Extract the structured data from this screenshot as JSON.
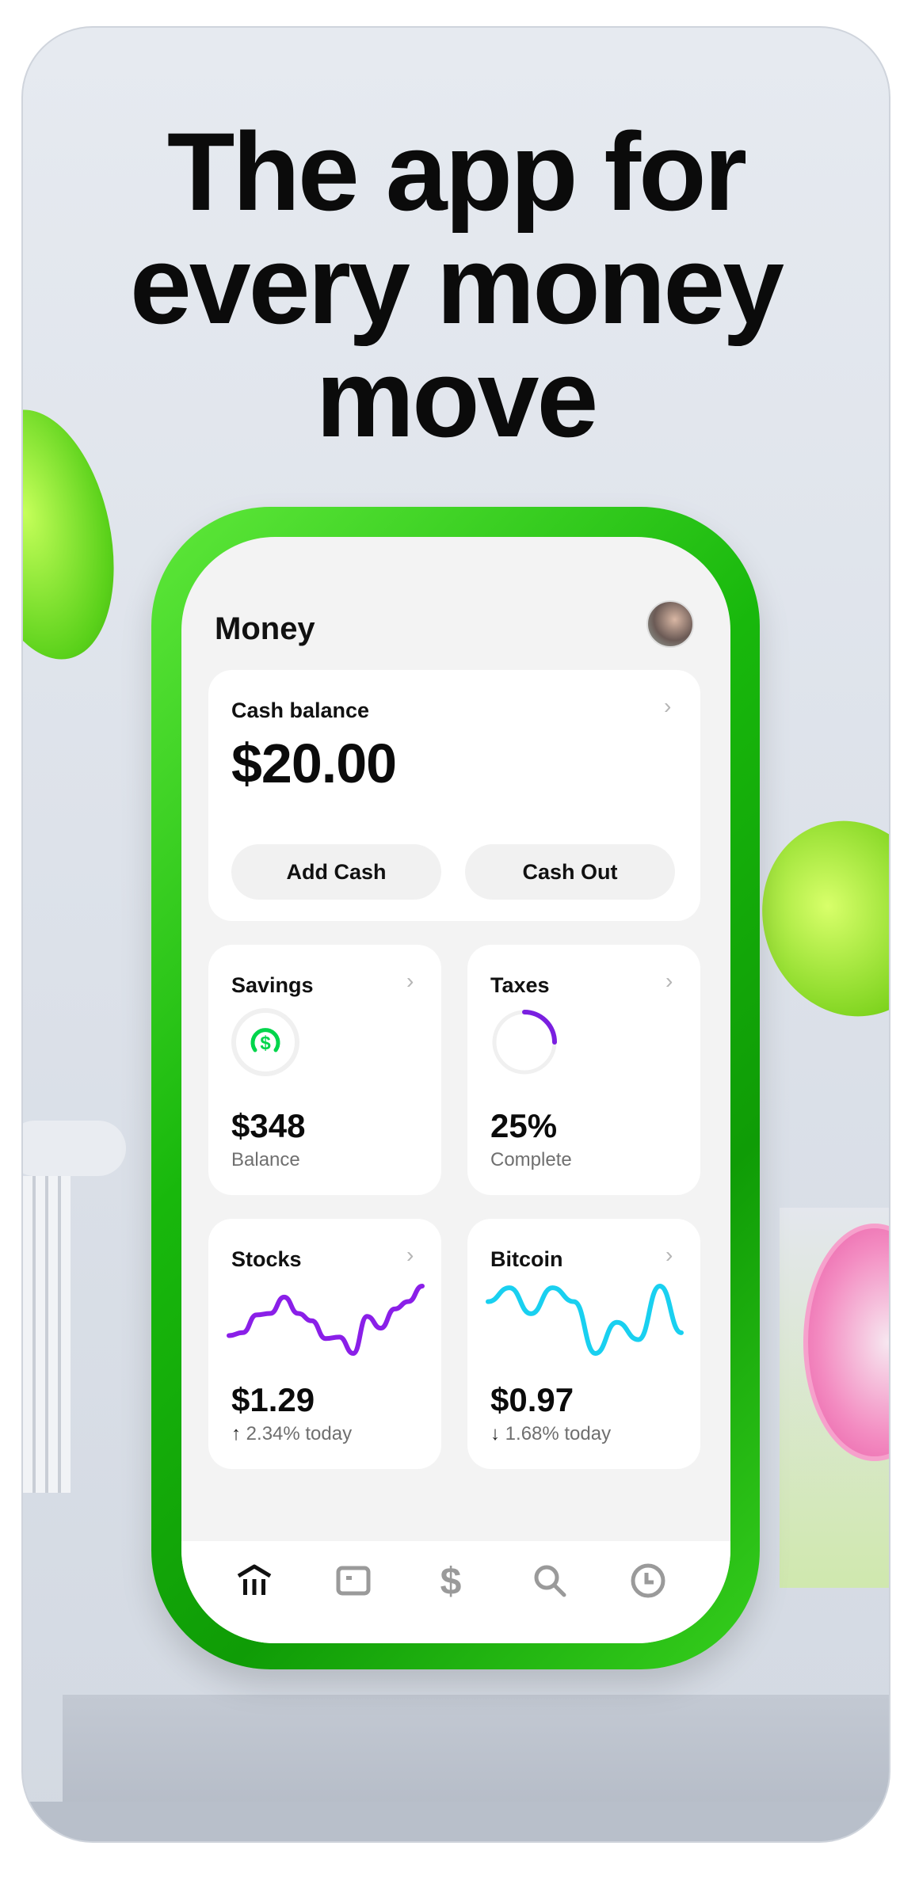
{
  "headline": [
    "The app for",
    "every money",
    "move"
  ],
  "app": {
    "title": "Money",
    "cash_card": {
      "label": "Cash balance",
      "amount": "$20.00",
      "buttons": [
        "Add Cash",
        "Cash Out"
      ]
    },
    "savings": {
      "label": "Savings",
      "value": "$348",
      "sub": "Balance",
      "icon": "cash-dollar-circle-icon"
    },
    "taxes": {
      "label": "Taxes",
      "value": "25%",
      "sub": "Complete",
      "progress_percent": 25
    },
    "stocks": {
      "label": "Stocks",
      "value": "$1.29",
      "change": "2.34% today",
      "direction": "up"
    },
    "bitcoin": {
      "label": "Bitcoin",
      "value": "$0.97",
      "change": "1.68% today",
      "direction": "down"
    },
    "nav": [
      "bank-icon",
      "card-icon",
      "dollar-icon",
      "search-icon",
      "clock-icon"
    ]
  },
  "chart_data": [
    {
      "type": "line",
      "name": "Stocks",
      "values": [
        75,
        85,
        145,
        150,
        205,
        150,
        125,
        65,
        70,
        15,
        140,
        100,
        165,
        190,
        242
      ],
      "color": "#8a1fe8"
    },
    {
      "type": "line",
      "name": "Bitcoin",
      "values": [
        180,
        220,
        145,
        220,
        180,
        30,
        120,
        70,
        225,
        90
      ],
      "color": "#19d0f0"
    }
  ],
  "colors": {
    "brand_green": "#00d54b",
    "frame_green": "#18b80c",
    "taxes_purple": "#7a1fe0",
    "stocks_purple": "#8a1fe8",
    "bitcoin_cyan": "#19d0f0"
  }
}
